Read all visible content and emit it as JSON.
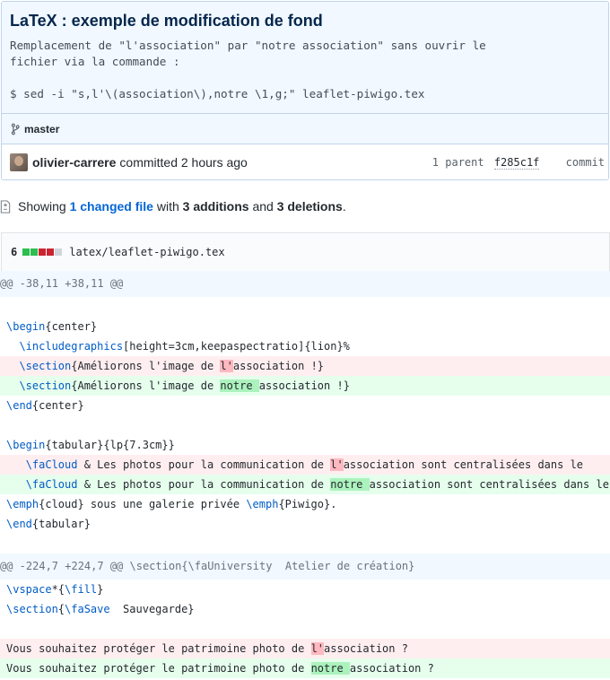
{
  "commit": {
    "title": "LaTeX : exemple de modification de fond",
    "description": "Remplacement de \"l'association\" par \"notre association\" sans ouvrir le\nfichier via la commande :\n\n$ sed -i \"s,l'\\(association\\),notre \\1,g;\" leaflet-piwigo.tex",
    "branch": "master",
    "author": "olivier-carrere",
    "committed": "committed 2 hours ago",
    "parents": "1 parent",
    "parent_sha": "f285c1f",
    "commit_label": "commit"
  },
  "toc": {
    "showing": "Showing",
    "changed_files": "1 changed file",
    "with": "with",
    "additions": "3 additions",
    "and": "and",
    "deletions": "3 deletions",
    "period": "."
  },
  "file": {
    "count": "6",
    "path": "latex/leaflet-piwigo.tex",
    "colors": {
      "addition": "#2cbe4e",
      "deletion": "#cb2431",
      "neutral": "#d1d5da"
    }
  },
  "diff": {
    "hunk1": "@@ -38,11 +38,11 @@",
    "hunk2": "@@ -224,7 +224,7 @@ \\section{\\faUniversity  Atelier de création}",
    "l1_kw": "\\begin",
    "l1_rest": "{center}",
    "l2_kw": "\\includegraphics",
    "l2_rest": "[height=3cm,keepaspectratio]{lion}%",
    "l3_kw": "\\section",
    "l3_pre": "{Améliorons l'image de ",
    "l3_hl": "l'",
    "l3_post": "association !}",
    "l4_kw": "\\section",
    "l4_pre": "{Améliorons l'image de ",
    "l4_hl": "notre ",
    "l4_post": "association !}",
    "l5_kw": "\\end",
    "l5_rest": "{center}",
    "l6_kw": "\\begin",
    "l6_rest": "{tabular}{lp{7.3cm}}",
    "l7_kw": "\\faCloud",
    "l7_pre": " & Les photos pour la communication de ",
    "l7_hl": "l'",
    "l7_post": "association sont centralisées dans le",
    "l8_kw": "\\faCloud",
    "l8_pre": " & Les photos pour la communication de ",
    "l8_hl": "notre ",
    "l8_post": "association sont centralisées dans le",
    "l9_kw": "\\emph",
    "l9_mid": "{cloud} sous une galerie privée ",
    "l9_kw2": "\\emph",
    "l9_post": "{Piwigo}.",
    "l10_kw": "\\end",
    "l10_rest": "{tabular}",
    "l11_kw": "\\vspace",
    "l11_mid": "*{",
    "l11_kw2": "\\fill",
    "l11_post": "}",
    "l12_kw": "\\section",
    "l12_mid": "{",
    "l12_kw2": "\\faSave",
    "l12_post": "  Sauvegarde}",
    "l13_pre": "Vous souhaitez protéger le patrimoine photo de ",
    "l13_hl": "l'",
    "l13_post": "association ?",
    "l14_pre": "Vous souhaitez protéger le patrimoine photo de ",
    "l14_hl": "notre ",
    "l14_post": "association ?"
  }
}
